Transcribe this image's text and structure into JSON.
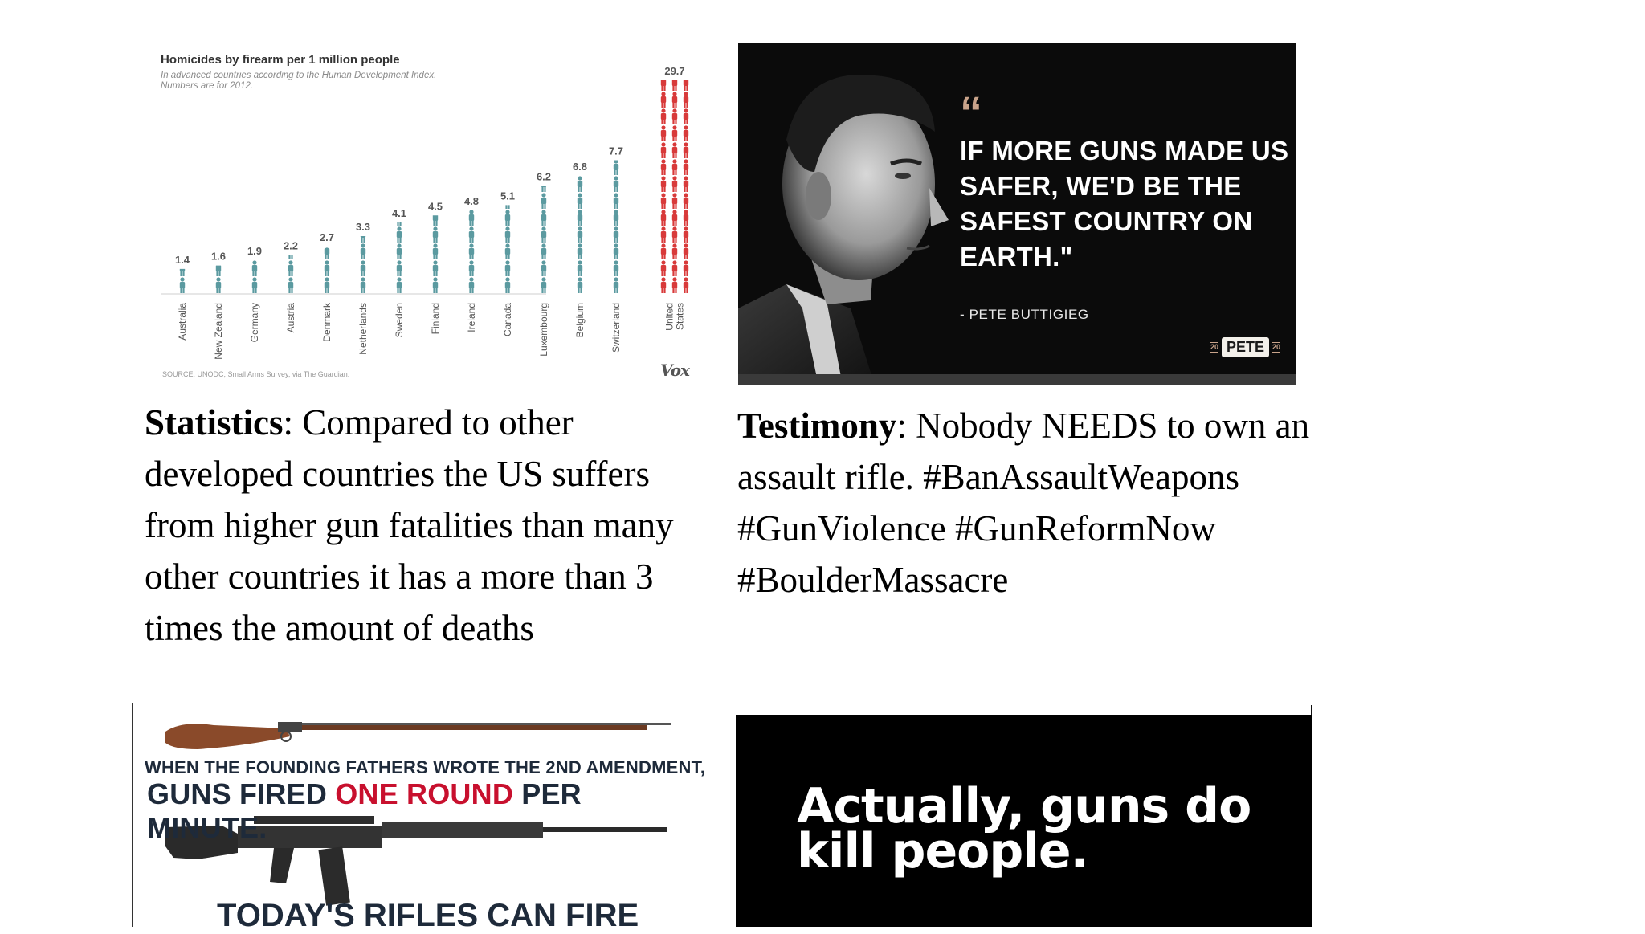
{
  "chart_data": {
    "type": "bar",
    "title": "Homicides by firearm per 1 million people",
    "subtitle_line1": "In advanced countries according to the Human Development Index.",
    "subtitle_line2": "Numbers are for 2012.",
    "categories": [
      "Australia",
      "New Zealand",
      "Germany",
      "Austria",
      "Denmark",
      "Netherlands",
      "Sweden",
      "Finland",
      "Ireland",
      "Canada",
      "Luxembourg",
      "Belgium",
      "Switzerland",
      "United States"
    ],
    "category_lines": [
      [
        "Australia"
      ],
      [
        "New Zealand"
      ],
      [
        "Germany"
      ],
      [
        "Austria"
      ],
      [
        "Denmark"
      ],
      [
        "Netherlands"
      ],
      [
        "Sweden"
      ],
      [
        "Finland"
      ],
      [
        "Ireland"
      ],
      [
        "Canada"
      ],
      [
        "Luxembourg"
      ],
      [
        "Belgium"
      ],
      [
        "Switzerland"
      ],
      [
        "United",
        "States"
      ]
    ],
    "values": [
      1.4,
      1.6,
      1.9,
      2.2,
      2.7,
      3.3,
      4.1,
      4.5,
      4.8,
      5.1,
      6.2,
      6.8,
      7.7,
      29.7
    ],
    "value_labels": [
      "1.4",
      "1.6",
      "1.9",
      "2.2",
      "2.7",
      "3.3",
      "4.1",
      "4.5",
      "4.8",
      "5.1",
      "6.2",
      "6.8",
      "7.7",
      "29.7"
    ],
    "colors": {
      "default": "#5b9aa0",
      "highlight": "#d83a3a"
    },
    "highlight_index": 13,
    "source": "SOURCE: UNODC, Small Arms Survey, via The Guardian.",
    "logo": "Vox",
    "grid": false
  },
  "captions": {
    "statistics_label": "Statistics",
    "statistics_text": ": Compared to other developed countries the US suffers from higher gun fatalities than many other countries it has a more than 3 times the amount of deaths",
    "testimony_label": "Testimony",
    "testimony_text": ": Nobody NEEDS to own an assault rifle. #BanAssaultWeapons #GunViolence #GunReformNow #BoulderMassacre"
  },
  "quote_panel": {
    "quote_mark": "“",
    "quote": "IF MORE GUNS MADE US SAFER, WE'D BE THE SAFEST COUNTRY ON EARTH.\"",
    "author": "- PETE BUTTIGIEG",
    "badge_name": "PETE",
    "badge_year": "20",
    "photo_icon": "portrait-photo"
  },
  "rifle_panel": {
    "line1": "WHEN THE FOUNDING FATHERS WROTE THE 2ND AMENDMENT,",
    "line2_prefix": "GUNS FIRED ",
    "line2_highlight": "ONE ROUND",
    "line2_suffix": " PER MINUTE.",
    "line3": "TODAY'S RIFLES CAN FIRE",
    "highlight_color": "#c8102e",
    "musket_icon": "musket-icon",
    "rifle_icon": "assault-rifle-icon"
  },
  "black_panel": {
    "text": "Actually, guns do kill people."
  }
}
